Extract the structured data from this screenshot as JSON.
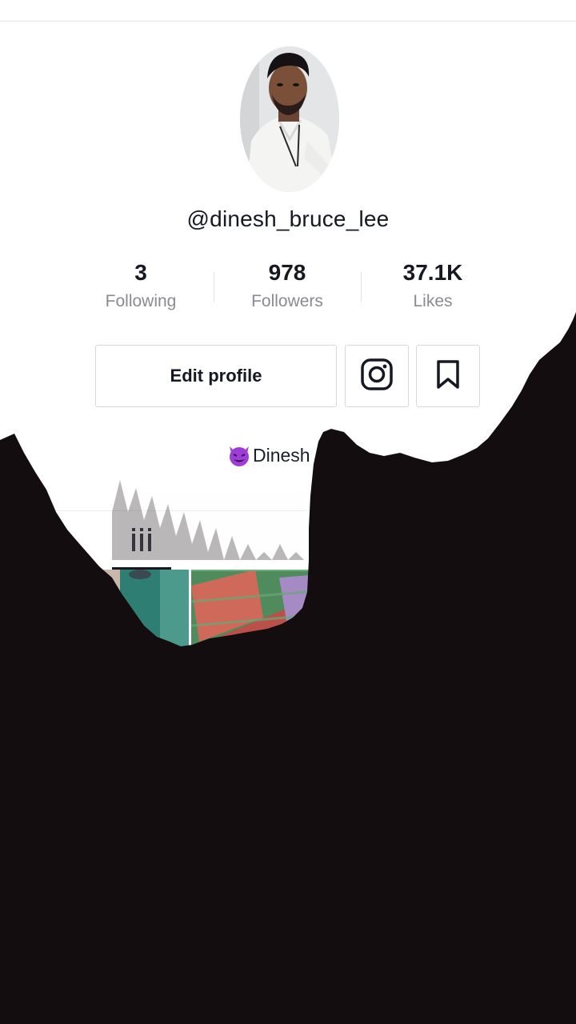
{
  "profile": {
    "username": "@dinesh_bruce_lee",
    "bio_text": "Dinesh",
    "bio_emoji": "smiling-devil-emoji"
  },
  "stats": [
    {
      "value": "3",
      "label": "Following"
    },
    {
      "value": "978",
      "label": "Followers"
    },
    {
      "value": "37.1K",
      "label": "Likes"
    }
  ],
  "actions": {
    "edit_profile_label": "Edit profile",
    "instagram_icon": "instagram-icon",
    "bookmark_icon": "bookmark-icon"
  },
  "tabs": {
    "active_tab_icon": "grid-icon"
  },
  "colors": {
    "text_primary": "#161823",
    "text_secondary": "#8a8b91",
    "border": "#d8d8da",
    "overlay_dark": "#140d0f"
  }
}
